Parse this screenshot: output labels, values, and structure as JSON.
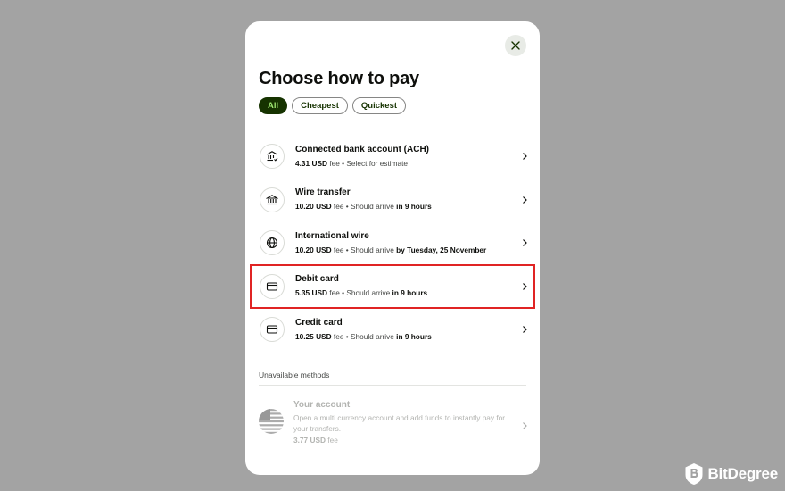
{
  "modal": {
    "title": "Choose how to pay",
    "close_icon": "close-icon"
  },
  "filters": [
    {
      "label": "All",
      "active": true
    },
    {
      "label": "Cheapest",
      "active": false
    },
    {
      "label": "Quickest",
      "active": false
    }
  ],
  "methods": [
    {
      "name": "Connected bank account (ACH)",
      "icon": "bank-connected-icon",
      "fee": "4.31 USD",
      "fee_suffix": " fee • Select for estimate",
      "arrival_prefix": "",
      "arrival": ""
    },
    {
      "name": "Wire transfer",
      "icon": "bank-icon",
      "fee": "10.20 USD",
      "fee_suffix": " fee • Should arrive ",
      "arrival_prefix": "",
      "arrival": "in 9 hours"
    },
    {
      "name": "International wire",
      "icon": "globe-icon",
      "fee": "10.20 USD",
      "fee_suffix": " fee • Should arrive ",
      "arrival_prefix": "",
      "arrival": "by Tuesday, 25 November"
    },
    {
      "name": "Debit card",
      "icon": "card-icon",
      "fee": "5.35 USD",
      "fee_suffix": " fee • Should arrive ",
      "arrival_prefix": "",
      "arrival": "in 9 hours",
      "highlighted": true
    },
    {
      "name": "Credit card",
      "icon": "card-icon",
      "fee": "10.25 USD",
      "fee_suffix": " fee • Should arrive ",
      "arrival_prefix": "",
      "arrival": "in 9 hours"
    }
  ],
  "unavailable": {
    "section_label": "Unavailable methods",
    "name": "Your account",
    "description": "Open a multi currency account and add funds to instantly pay for your transfers.",
    "fee": "3.77 USD",
    "fee_suffix": " fee",
    "icon": "us-flag-icon"
  },
  "watermark": {
    "text": "BitDegree",
    "icon": "bitdegree-logo-icon"
  },
  "colors": {
    "primary": "#163300",
    "accent": "#9fe870",
    "highlight": "#e02424",
    "overlay": "#a3a3a3"
  }
}
